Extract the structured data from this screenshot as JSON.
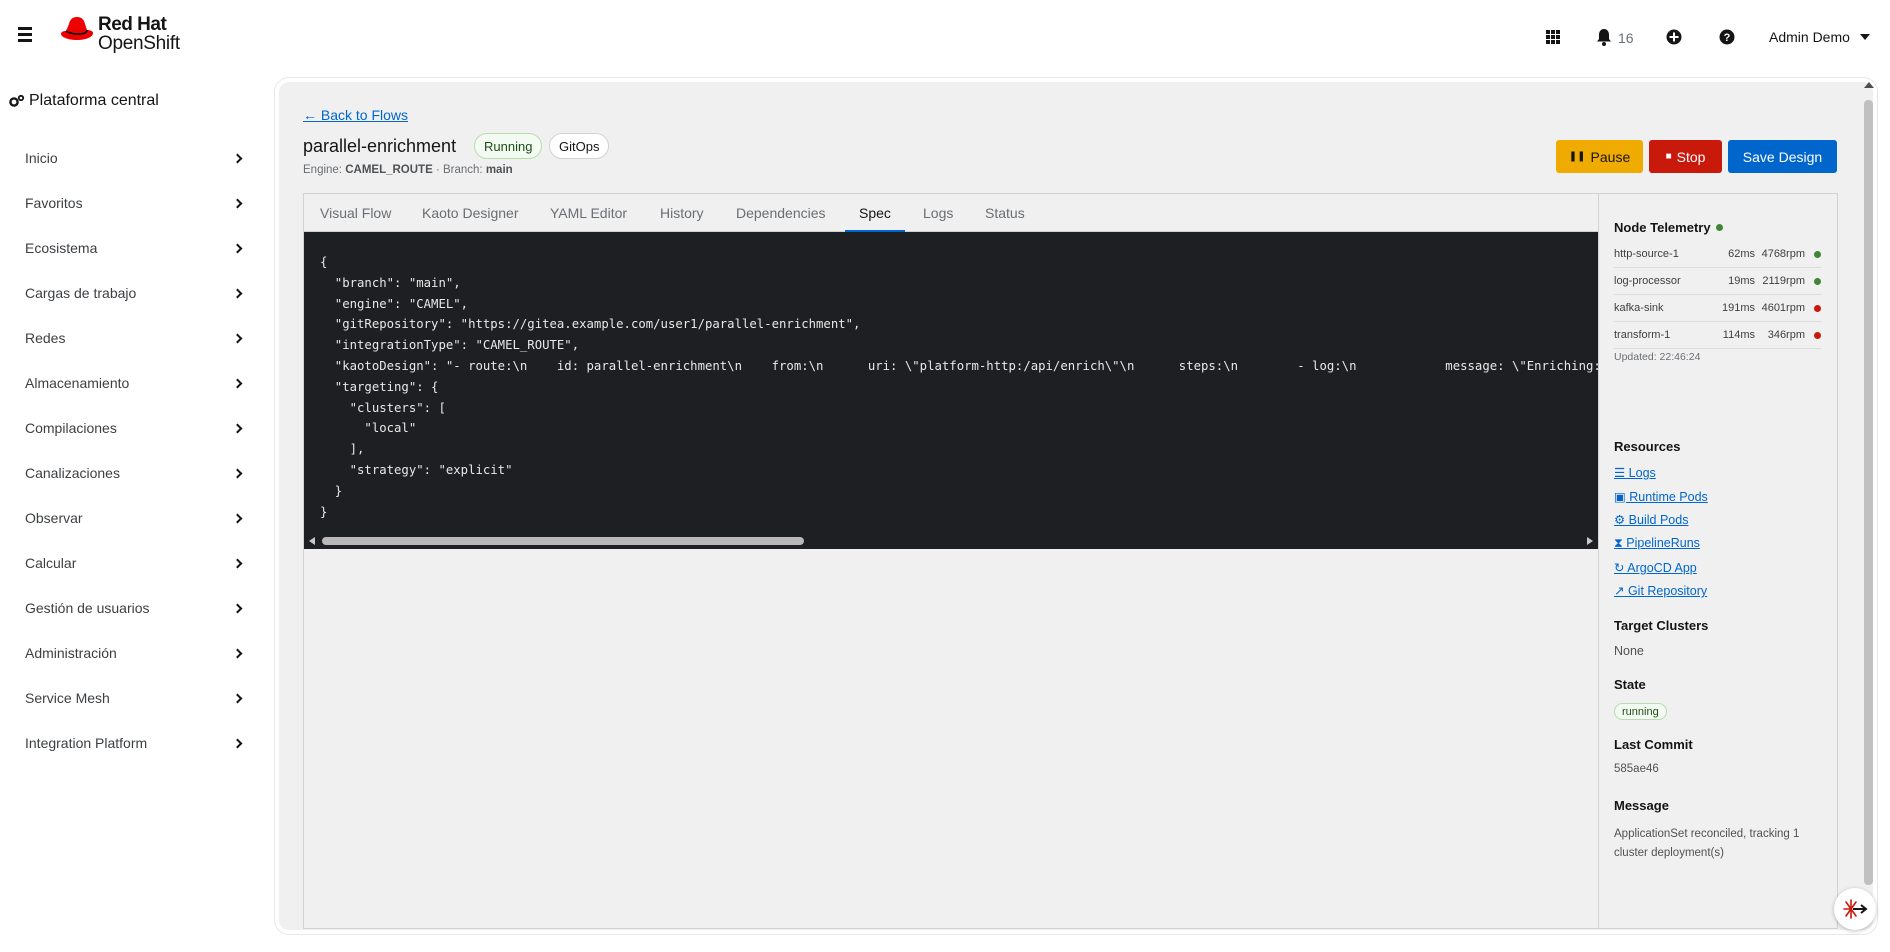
{
  "brand": {
    "line1": "Red Hat",
    "line2": "OpenShift"
  },
  "masthead": {
    "notification_count": "16",
    "user": "Admin Demo"
  },
  "sidebar": {
    "perspective": "Plataforma central",
    "items": [
      {
        "label": "Inicio"
      },
      {
        "label": "Favoritos"
      },
      {
        "label": "Ecosistema"
      },
      {
        "label": "Cargas de trabajo"
      },
      {
        "label": "Redes"
      },
      {
        "label": "Almacenamiento"
      },
      {
        "label": "Compilaciones"
      },
      {
        "label": "Canalizaciones"
      },
      {
        "label": "Observar"
      },
      {
        "label": "Calcular"
      },
      {
        "label": "Gestión de usuarios"
      },
      {
        "label": "Administración"
      },
      {
        "label": "Service Mesh"
      },
      {
        "label": "Integration Platform"
      }
    ]
  },
  "header": {
    "back_link": "← Back to Flows",
    "title": "parallel-enrichment",
    "status_badge": "Running",
    "mode_badge": "GitOps",
    "engine_label": "Engine:",
    "engine_value": "CAMEL_ROUTE",
    "branch_label": "· Branch:",
    "branch_value": "main"
  },
  "actions": {
    "pause": "Pause",
    "stop": "Stop",
    "save": "Save Design"
  },
  "tabs": [
    {
      "label": "Visual Flow",
      "active": false
    },
    {
      "label": "Kaoto Designer",
      "active": false
    },
    {
      "label": "YAML Editor",
      "active": false
    },
    {
      "label": "History",
      "active": false
    },
    {
      "label": "Dependencies",
      "active": false
    },
    {
      "label": "Spec",
      "active": true
    },
    {
      "label": "Logs",
      "active": false
    },
    {
      "label": "Status",
      "active": false
    }
  ],
  "spec_json": "{\n  \"branch\": \"main\",\n  \"engine\": \"CAMEL\",\n  \"gitRepository\": \"https://gitea.example.com/user1/parallel-enrichment\",\n  \"integrationType\": \"CAMEL_ROUTE\",\n  \"kaotoDesign\": \"- route:\\n    id: parallel-enrichment\\n    from:\\n      uri: \\\"platform-http:/api/enrich\\\"\\n      steps:\\n        - log:\\n            message: \\\"Enriching: ${body}\\\"\",\n  \"targeting\": {\n    \"clusters\": [\n      \"local\"\n    ],\n    \"strategy\": \"explicit\"\n  }\n}",
  "telemetry": {
    "title": "Node Telemetry",
    "status_color": "#3e8635",
    "rows": [
      {
        "name": "http-source-1",
        "latency": "62ms",
        "rate": "4768rpm",
        "status": "ok",
        "color": "#3e8635"
      },
      {
        "name": "log-processor",
        "latency": "19ms",
        "rate": "2119rpm",
        "status": "ok",
        "color": "#3e8635"
      },
      {
        "name": "kafka-sink",
        "latency": "191ms",
        "rate": "4601rpm",
        "status": "error",
        "color": "#c9190b"
      },
      {
        "name": "transform-1",
        "latency": "114ms",
        "rate": "346rpm",
        "status": "error",
        "color": "#c9190b"
      }
    ],
    "updated": "Updated: 22:46:24"
  },
  "resources": {
    "title": "Resources",
    "links": [
      {
        "label": "☰ Logs",
        "icon": "list-icon"
      },
      {
        "label": "▣ Runtime Pods",
        "icon": "pod-icon"
      },
      {
        "label": "⚙ Build Pods",
        "icon": "gear-icon"
      },
      {
        "label": "⧗ PipelineRuns",
        "icon": "pipeline-icon"
      },
      {
        "label": "↻ ArgoCD App",
        "icon": "sync-icon"
      },
      {
        "label": "↗ Git Repository",
        "icon": "external-link-icon"
      }
    ]
  },
  "target_clusters": {
    "title": "Target Clusters",
    "value": "None"
  },
  "state": {
    "title": "State",
    "value": "running"
  },
  "last_commit": {
    "title": "Last Commit",
    "value": "585ae46"
  },
  "message": {
    "title": "Message",
    "value": "ApplicationSet reconciled, tracking 1 cluster deployment(s)"
  }
}
